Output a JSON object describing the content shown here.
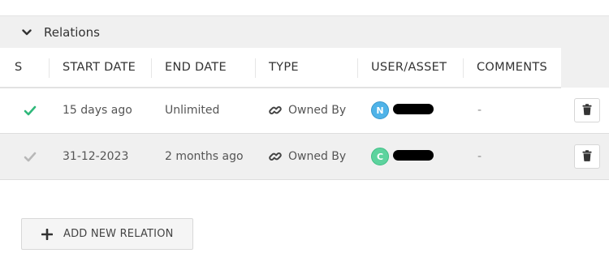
{
  "section": {
    "title": "Relations",
    "icon": "chevron-down-icon"
  },
  "table": {
    "columns": [
      "S",
      "START DATE",
      "END DATE",
      "TYPE",
      "USER/ASSET",
      "COMMENTS"
    ],
    "rows": [
      {
        "status_icon": "check-icon",
        "status_color": "#2fb87a",
        "start_date": "15 days ago",
        "end_date": "Unlimited",
        "type_icon": "link-icon",
        "type": "Owned By",
        "avatar_initial": "N",
        "avatar_color": "#4fb3e8",
        "comments": "-"
      },
      {
        "status_icon": "check-icon",
        "status_color": "#b8b8b8",
        "start_date": "31-12-2023",
        "end_date": "2 months ago",
        "type_icon": "link-icon",
        "type": "Owned By",
        "avatar_initial": "C",
        "avatar_color": "#5dd39e",
        "comments": "-"
      }
    ]
  },
  "actions": {
    "add_label": "ADD NEW RELATION",
    "add_icon": "plus-icon",
    "delete_icon": "trash-icon"
  }
}
